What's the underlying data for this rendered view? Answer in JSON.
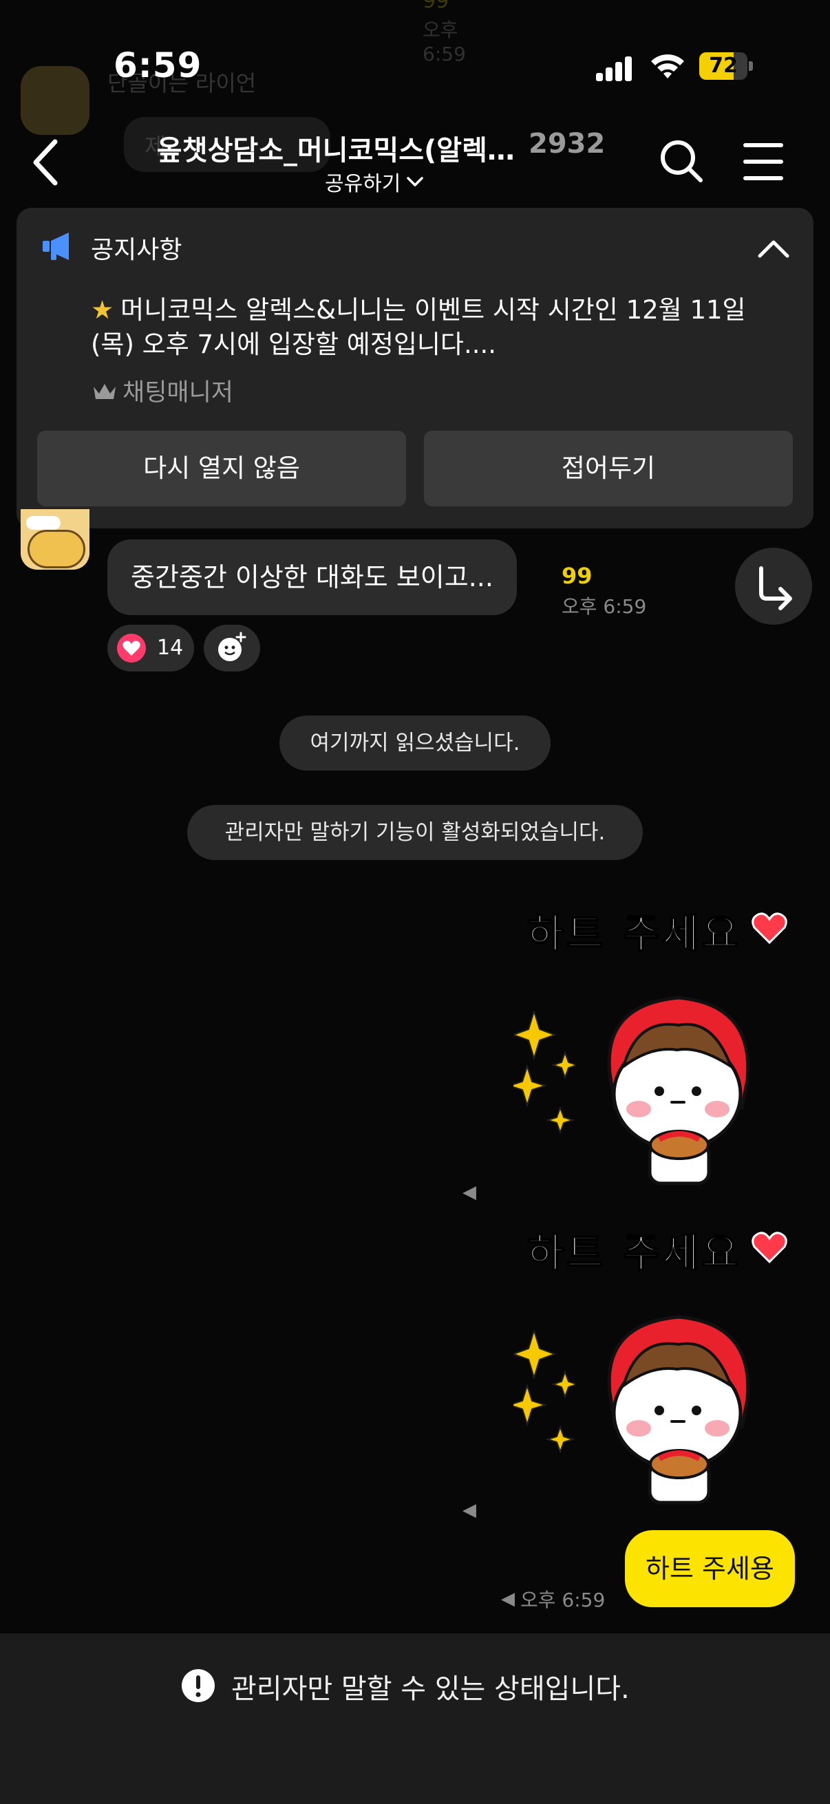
{
  "status_bar": {
    "time": "6:59",
    "battery_level": "72",
    "battery_fraction": 0.72
  },
  "ghost": {
    "count": "99",
    "time": "오후 6:59",
    "name": "단골이는 라이언",
    "bubble": "제"
  },
  "header": {
    "title": "옾챗상담소_머니코믹스(알렉스&니니)",
    "member_count": "2932",
    "share_label": "공유하기"
  },
  "notice": {
    "title": "공지사항",
    "body": "머니코믹스 알렉스&니니는 이벤트 시작 시간인 12월 11일 (목) 오후 7시에 입장할 예정입니다....",
    "star": "★",
    "author": "채팅매니저",
    "dismiss_label": "다시 열지 않음",
    "fold_label": "접어두기"
  },
  "chat": {
    "incoming_message": "중간중간 이상한 대화도 보이고...",
    "incoming_unread": "99",
    "incoming_time": "오후 6:59",
    "reaction_count": "14",
    "read_marker": "여기까지 읽으셨습니다.",
    "system_notice": "관리자만 말하기 기능이 활성화되었습니다.",
    "sticker_caption": "하트 주세요",
    "outgoing_message": "하트 주세용",
    "outgoing_time": "오후 6:59"
  },
  "bottom_bar": {
    "message": "관리자만 말할 수 있는 상태입니다."
  },
  "colors": {
    "accent_yellow": "#fde400",
    "background": "#070707",
    "notice_bg": "#242424",
    "notice_icon": "#4a90ff",
    "heart": "#ff3b6b"
  }
}
